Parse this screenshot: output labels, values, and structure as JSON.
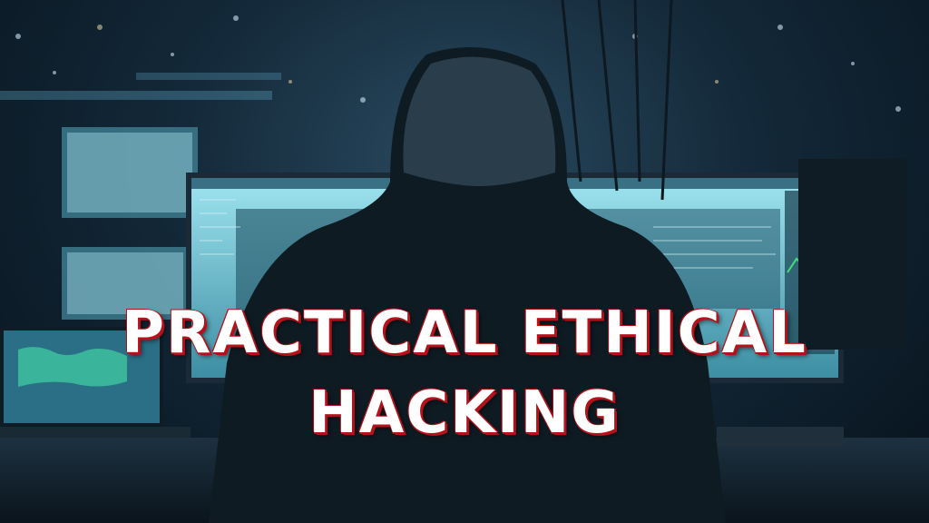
{
  "title": {
    "line1": "PRACTICAL ETHICAL",
    "line2": "HACKING"
  },
  "colors": {
    "title_text": "#ffffff",
    "title_outline": "#b3121a",
    "screen_glow": "#7fd3e6",
    "accent_green": "#3fe07a"
  }
}
